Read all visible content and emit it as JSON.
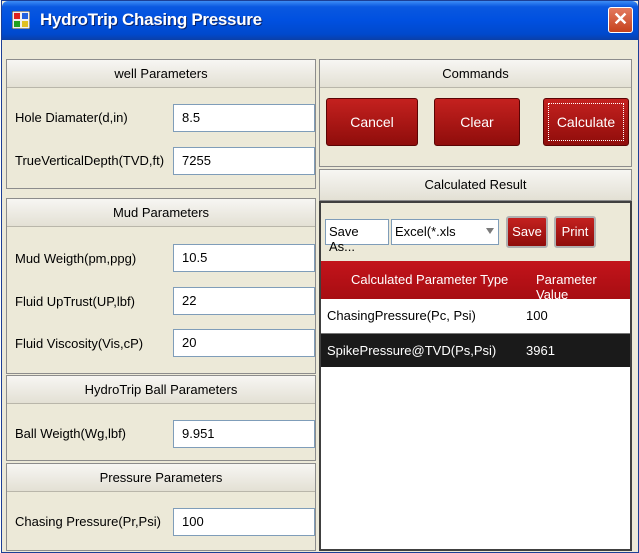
{
  "window": {
    "title": "HydroTrip Chasing Pressure",
    "close_icon": "close-icon"
  },
  "well": {
    "header": "well Parameters",
    "hole_diameter": {
      "label": "Hole Diamater(d,in)",
      "value": "8.5"
    },
    "tvd": {
      "label": "TrueVerticalDepth(TVD,ft)",
      "value": "7255"
    }
  },
  "mud": {
    "header": "Mud Parameters",
    "weight": {
      "label": "Mud Weigth(pm,ppg)",
      "value": "10.5"
    },
    "uptrust": {
      "label": "Fluid UpTrust(UP,lbf)",
      "value": "22"
    },
    "viscosity": {
      "label": "Fluid Viscosity(Vis,cP)",
      "value": "20"
    }
  },
  "ball": {
    "header": "HydroTrip Ball Parameters",
    "weight": {
      "label": "Ball Weigth(Wg,lbf)",
      "value": "9.951"
    }
  },
  "pressure": {
    "header": "Pressure  Parameters",
    "chasing": {
      "label": "Chasing  Pressure(Pr,Psi)",
      "value": "100"
    }
  },
  "commands": {
    "header": "Commands",
    "cancel": "Cancel",
    "clear": "Clear",
    "calculate": "Calculate"
  },
  "result": {
    "header": "Calculated Result",
    "save_as_label": "Save As...",
    "format_selected": "Excel(*.xls",
    "save": "Save",
    "print": "Print",
    "columns": [
      "Calculated Parameter Type",
      "Parameter Value"
    ],
    "rows": [
      {
        "type": "ChasingPressure(Pc, Psi)",
        "value": "100"
      },
      {
        "type": "SpikePressure@TVD(Ps,Psi)",
        "value": "3961"
      }
    ]
  },
  "colors": {
    "accent": "#b5121b",
    "titlebar": "#0050e0"
  }
}
